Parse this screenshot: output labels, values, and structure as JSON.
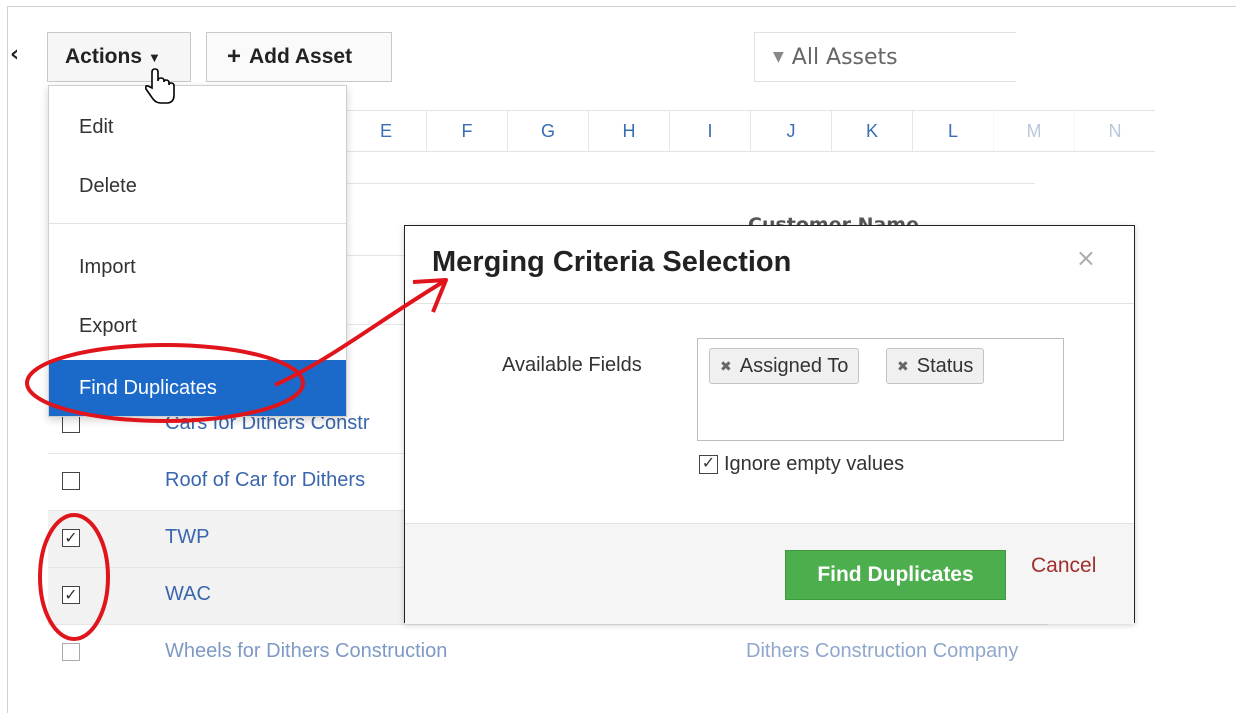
{
  "toolbar": {
    "back_label": "‹",
    "actions_label": "Actions",
    "add_asset_label": "Add Asset",
    "filter_label": "All Assets"
  },
  "alphabet": [
    "E",
    "F",
    "G",
    "H",
    "I",
    "J",
    "K",
    "L",
    "M",
    "N"
  ],
  "table": {
    "customer_name_header": "Customer Name",
    "rows": [
      {
        "name": "Cars for Dithers Constr",
        "customer": "",
        "checked": false
      },
      {
        "name": "Roof of Car for Dithers",
        "customer": "",
        "checked": false
      },
      {
        "name": "TWP",
        "customer": "",
        "checked": true
      },
      {
        "name": "WAC",
        "customer": "",
        "checked": true
      },
      {
        "name": "Wheels for Dithers Construction",
        "customer": "Dithers Construction Company",
        "checked": false
      }
    ]
  },
  "menu": {
    "items": [
      "Edit",
      "Delete",
      "Import",
      "Export",
      "Find Duplicates"
    ],
    "active": "Find Duplicates"
  },
  "dialog": {
    "title": "Merging Criteria Selection",
    "close_label": "×",
    "fields_label": "Available Fields",
    "tags": [
      "Assigned To",
      "Status"
    ],
    "ignore_empty_label": "Ignore empty values",
    "ignore_empty_checked": true,
    "find_button": "Find Duplicates",
    "cancel_label": "Cancel"
  },
  "colors": {
    "link": "#3966ad",
    "menu_active": "#1b6ac9",
    "find_button": "#4cae4c",
    "cancel": "#a0302b",
    "annotation": "#e0141b"
  }
}
